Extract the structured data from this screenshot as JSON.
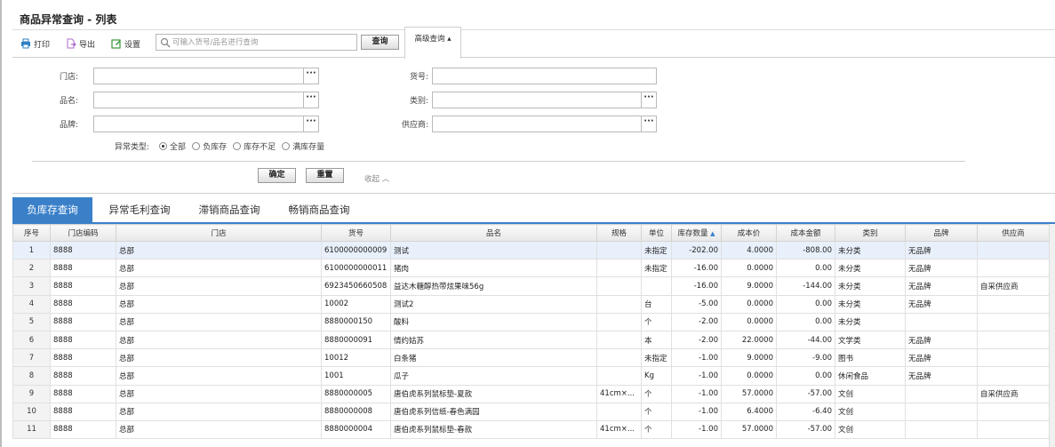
{
  "page": {
    "title": "商品异常查询 - 列表"
  },
  "toolbar": {
    "print_label": "打印",
    "export_label": "导出",
    "settings_label": "设置",
    "search_placeholder": "可输入货号/品名进行查询",
    "query_label": "查询",
    "advanced_label": "高级查询 ▴"
  },
  "filters": {
    "store_label": "门店:",
    "product_name_label": "品名:",
    "brand_label": "品牌:",
    "item_no_label": "货号:",
    "category_label": "类别:",
    "supplier_label": "供应商:",
    "abnormal_type_label": "异常类型:",
    "options": [
      "全部",
      "负库存",
      "库存不足",
      "满库存量"
    ],
    "selected_option": "全部",
    "confirm_label": "确定",
    "reset_label": "重置",
    "collapse_label": "收起 ︿",
    "dots": "···"
  },
  "tabs": [
    {
      "label": "负库存查询",
      "active": true
    },
    {
      "label": "异常毛利查询",
      "active": false
    },
    {
      "label": "滞销商品查询",
      "active": false
    },
    {
      "label": "畅销商品查询",
      "active": false
    }
  ],
  "table": {
    "columns": [
      "序号",
      "门店编码",
      "门店",
      "货号",
      "品名",
      "规格",
      "单位",
      "库存数量",
      "成本价",
      "成本金额",
      "类别",
      "品牌",
      "供应商"
    ],
    "sort_indicator": "▲",
    "rows": [
      [
        "1",
        "8888",
        "总部",
        "6100000000009",
        "测试",
        "",
        "未指定",
        "-202.00",
        "4.0000",
        "-808.00",
        "未分类",
        "无品牌",
        ""
      ],
      [
        "2",
        "8888",
        "总部",
        "6100000000011",
        "猪肉",
        "",
        "未指定",
        "-16.00",
        "0.0000",
        "0.00",
        "未分类",
        "无品牌",
        ""
      ],
      [
        "3",
        "8888",
        "总部",
        "6923450660508",
        "益达木糖醇热带炫果味56g",
        "",
        "",
        "-16.00",
        "9.0000",
        "-144.00",
        "未分类",
        "无品牌",
        "自采供应商"
      ],
      [
        "4",
        "8888",
        "总部",
        "10002",
        "测试2",
        "",
        "台",
        "-5.00",
        "0.0000",
        "0.00",
        "未分类",
        "无品牌",
        ""
      ],
      [
        "5",
        "8888",
        "总部",
        "8880000150",
        "酸料",
        "",
        "个",
        "-2.00",
        "0.0000",
        "0.00",
        "未分类",
        "",
        ""
      ],
      [
        "6",
        "8888",
        "总部",
        "8880000091",
        "情约姑苏",
        "",
        "本",
        "-2.00",
        "22.0000",
        "-44.00",
        "文学类",
        "无品牌",
        ""
      ],
      [
        "7",
        "8888",
        "总部",
        "10012",
        "白条猪",
        "",
        "未指定",
        "-1.00",
        "9.0000",
        "-9.00",
        "图书",
        "无品牌",
        ""
      ],
      [
        "8",
        "8888",
        "总部",
        "1001",
        "瓜子",
        "",
        "Kg",
        "-1.00",
        "0.0000",
        "0.00",
        "休闲食品",
        "无品牌",
        ""
      ],
      [
        "9",
        "8888",
        "总部",
        "8880000005",
        "唐伯虎系列鼠标垫-夏款",
        "41cm×...",
        "个",
        "-1.00",
        "57.0000",
        "-57.00",
        "文创",
        "",
        "自采供应商"
      ],
      [
        "10",
        "8888",
        "总部",
        "8880000008",
        "唐伯虎系列信纸-春色满园",
        "",
        "个",
        "-1.00",
        "6.4000",
        "-6.40",
        "文创",
        "",
        ""
      ],
      [
        "11",
        "8888",
        "总部",
        "8880000004",
        "唐伯虎系列鼠标垫-春款",
        "41cm×...",
        "个",
        "-1.00",
        "57.0000",
        "-57.00",
        "文创",
        "",
        ""
      ]
    ]
  },
  "colors": {
    "accent": "#3a80c9",
    "selected_row": "#e8f0fb"
  }
}
